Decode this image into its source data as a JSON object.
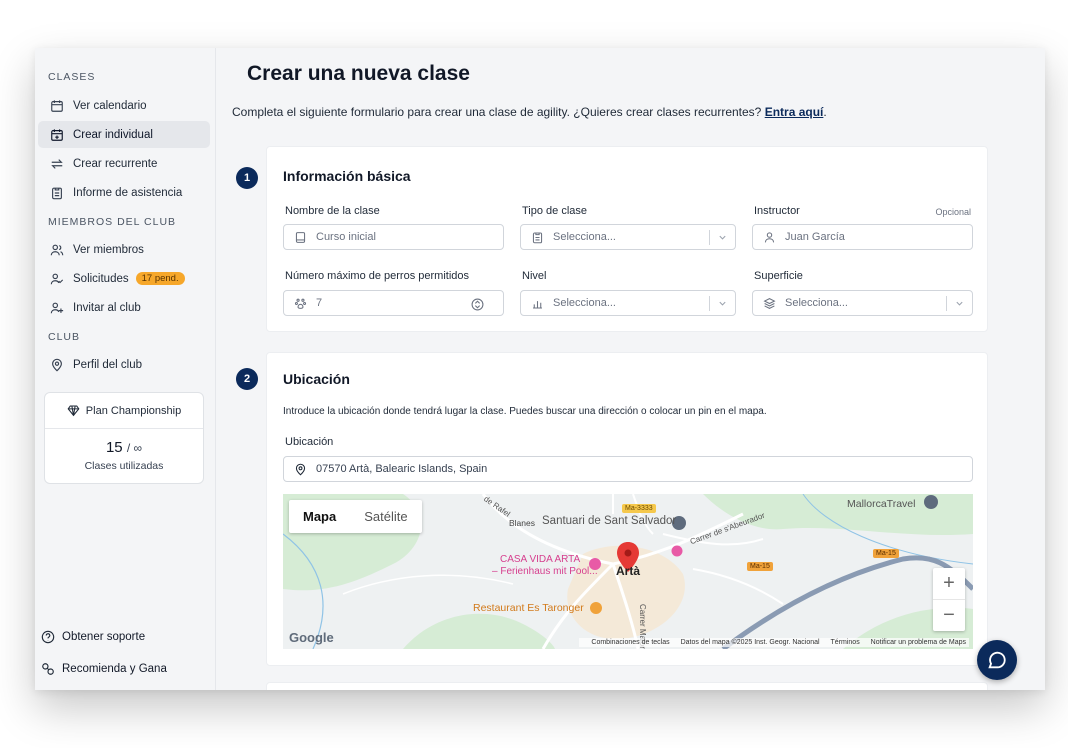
{
  "sidebar": {
    "section_clases": "CLASES",
    "ver_calendario": "Ver calendario",
    "crear_individual": "Crear individual",
    "crear_recurrente": "Crear recurrente",
    "informe_asistencia": "Informe de asistencia",
    "section_miembros": "MIEMBROS DEL CLUB",
    "ver_miembros": "Ver miembros",
    "solicitudes": "Solicitudes",
    "solicitudes_badge": "17 pend.",
    "invitar": "Invitar al club",
    "section_club": "CLUB",
    "perfil": "Perfil del club",
    "plan_name": "Plan Championship",
    "plan_used": "15",
    "plan_limit": "/ ∞",
    "plan_caption": "Clases utilizadas",
    "soporte": "Obtener soporte",
    "recomienda": "Recomienda y Gana"
  },
  "page": {
    "title": "Crear una nueva clase",
    "intro": "Completa el siguiente formulario para crear una clase de agility. ¿Quieres crear clases recurrentes? ",
    "intro_link": "Entra aquí",
    "intro_end": "."
  },
  "basic": {
    "step": "1",
    "title": "Información básica",
    "name_label": "Nombre de la clase",
    "name_placeholder": "Curso inicial",
    "type_label": "Tipo de clase",
    "type_value": "Selecciona...",
    "instructor_label": "Instructor",
    "instructor_optional": "Opcional",
    "instructor_placeholder": "Juan García",
    "max_dogs_label": "Número máximo de perros permitidos",
    "max_dogs_value": "7",
    "level_label": "Nivel",
    "level_value": "Selecciona...",
    "surface_label": "Superficie",
    "surface_value": "Selecciona..."
  },
  "location": {
    "step": "2",
    "title": "Ubicación",
    "description": "Introduce la ubicación donde tendrá lugar la clase. Puedes buscar una dirección o colocar un pin en el mapa.",
    "label": "Ubicación",
    "value": "07570 Artà, Balearic Islands, Spain"
  },
  "map": {
    "tab_map": "Mapa",
    "tab_satellite": "Satélite",
    "zoom_in": "+",
    "zoom_out": "−",
    "label_santuari": "Santuari de Sant Salvador",
    "label_blanes": "Blanes",
    "label_rafel": "de Rafel",
    "label_casa_vida_1": "CASA VIDA ARTA",
    "label_casa_vida_2": "– Ferienhaus mit Pool...",
    "label_arta": "Artà",
    "label_restaurant": "Restaurant Es Taronger",
    "label_carrer_major": "Carrer Major",
    "label_abeurador": "Carrer de s'Abeurador",
    "label_mallorca": "MallorcaTravel",
    "shield_ma3333": "Ma-3333",
    "shield_ma15_a": "Ma-15",
    "shield_ma15_b": "Ma-15",
    "google": "Google",
    "attr_keys": "Combinaciones de teclas",
    "attr_data": "Datos del mapa ©2025 Inst. Geogr. Nacional",
    "attr_terms": "Términos",
    "attr_report": "Notificar un problema de Maps"
  },
  "colors": {
    "navy": "#0b2a5b",
    "badge": "#f6a72a",
    "pin": "#e53935"
  }
}
